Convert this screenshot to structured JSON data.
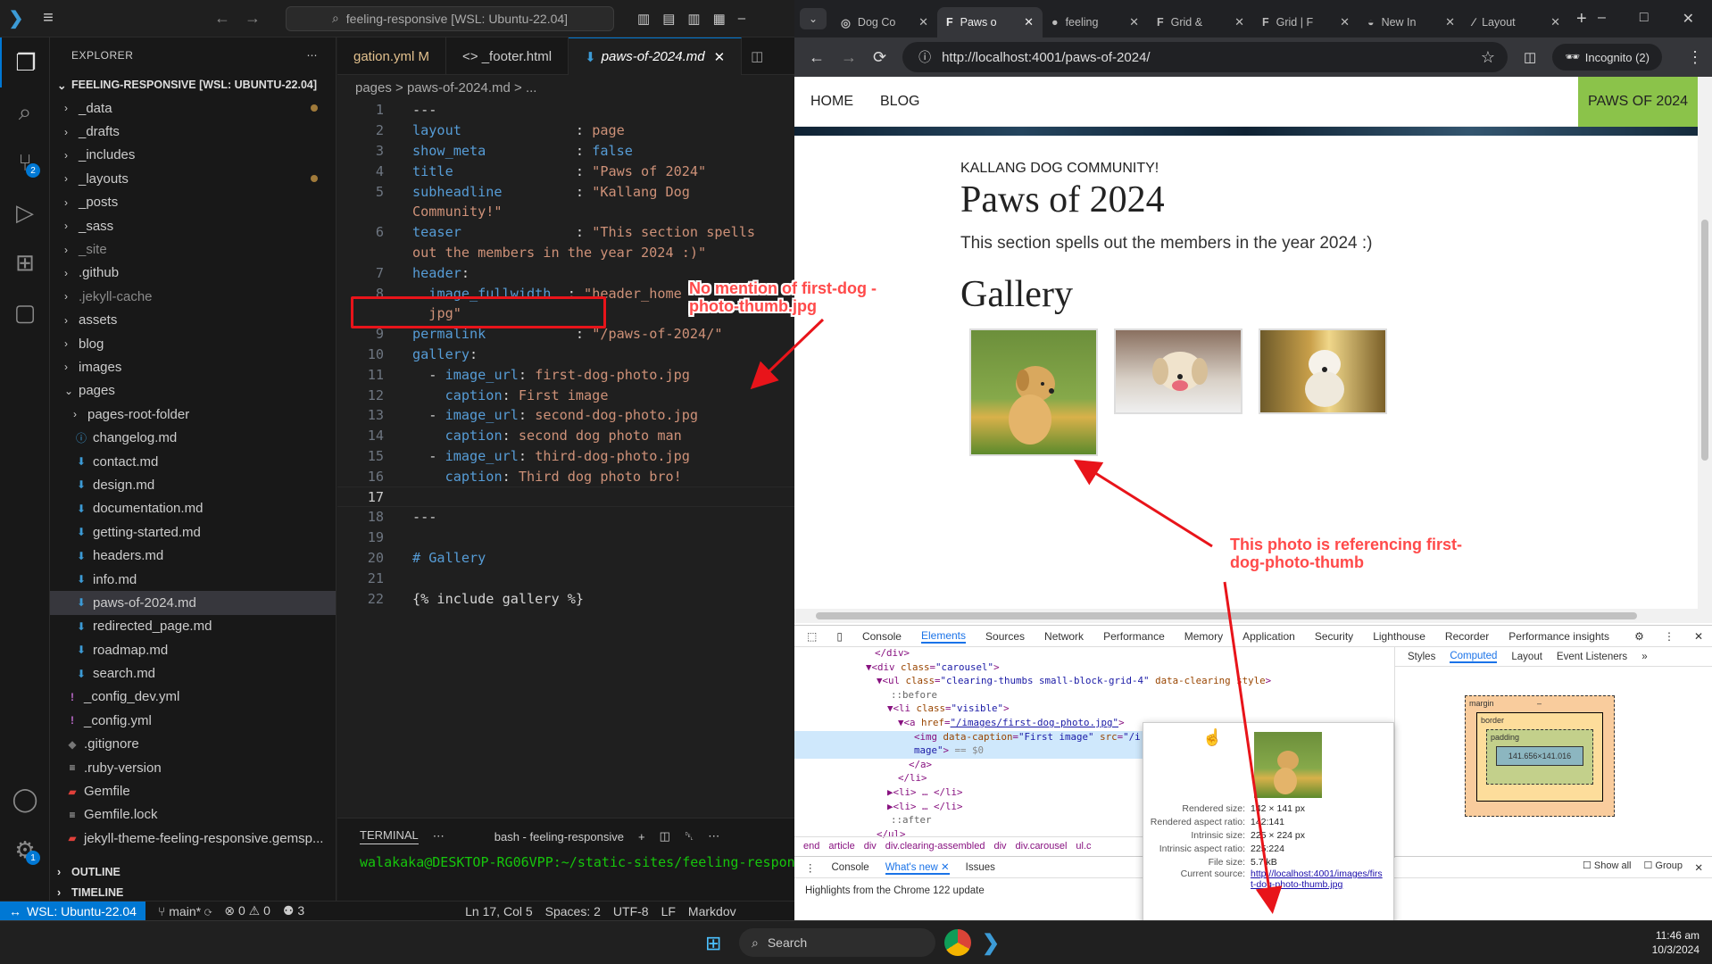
{
  "vscode": {
    "command_center": "feeling-responsive [WSL: Ubuntu-22.04]",
    "explorer_title": "EXPLORER",
    "root": "FEELING-RESPONSIVE [WSL: UBUNTU-22.04]",
    "source_control_badge": "2",
    "settings_badge": "1",
    "tree": [
      {
        "label": "_data",
        "type": "folder",
        "modified": true
      },
      {
        "label": "_drafts",
        "type": "folder"
      },
      {
        "label": "_includes",
        "type": "folder"
      },
      {
        "label": "_layouts",
        "type": "folder",
        "modified": true
      },
      {
        "label": "_posts",
        "type": "folder"
      },
      {
        "label": "_sass",
        "type": "folder"
      },
      {
        "label": "_site",
        "type": "folder",
        "dim": true
      },
      {
        "label": ".github",
        "type": "folder"
      },
      {
        "label": ".jekyll-cache",
        "type": "folder",
        "dim": true
      },
      {
        "label": "assets",
        "type": "folder"
      },
      {
        "label": "blog",
        "type": "folder"
      },
      {
        "label": "images",
        "type": "folder"
      },
      {
        "label": "pages",
        "type": "folder-open"
      },
      {
        "label": "pages-root-folder",
        "type": "subfolder"
      },
      {
        "label": "changelog.md",
        "type": "file",
        "icon": "info"
      },
      {
        "label": "contact.md",
        "type": "file"
      },
      {
        "label": "design.md",
        "type": "file"
      },
      {
        "label": "documentation.md",
        "type": "file"
      },
      {
        "label": "getting-started.md",
        "type": "file"
      },
      {
        "label": "headers.md",
        "type": "file"
      },
      {
        "label": "info.md",
        "type": "file"
      },
      {
        "label": "paws-of-2024.md",
        "type": "file",
        "selected": true
      },
      {
        "label": "redirected_page.md",
        "type": "file"
      },
      {
        "label": "roadmap.md",
        "type": "file"
      },
      {
        "label": "search.md",
        "type": "file"
      },
      {
        "label": "_config_dev.yml",
        "type": "yml"
      },
      {
        "label": "_config.yml",
        "type": "yml"
      },
      {
        "label": ".gitignore",
        "type": "git"
      },
      {
        "label": ".ruby-version",
        "type": "plain"
      },
      {
        "label": "Gemfile",
        "type": "ruby"
      },
      {
        "label": "Gemfile.lock",
        "type": "plain"
      },
      {
        "label": "jekyll-theme-feeling-responsive.gemsp...",
        "type": "ruby"
      }
    ],
    "outline": "OUTLINE",
    "timeline": "TIMELINE",
    "tabs": [
      {
        "label": "gation.yml M",
        "active": false
      },
      {
        "label": "<> _footer.html",
        "active": false
      },
      {
        "label": "paws-of-2024.md",
        "active": true
      }
    ],
    "breadcrumb": "pages > paws-of-2024.md > ...",
    "code_lines": [
      {
        "n": "1",
        "html": "<span class='p'>---</span>"
      },
      {
        "n": "2",
        "html": "<span class='k'>layout</span>              <span class='p'>: </span><span class='s'>page</span>"
      },
      {
        "n": "3",
        "html": "<span class='k'>show_meta</span>           <span class='p'>: </span><span class='k'>false</span>"
      },
      {
        "n": "4",
        "html": "<span class='k'>title</span>               <span class='p'>: </span><span class='s'>\"Paws of 2024\"</span>"
      },
      {
        "n": "5",
        "html": "<span class='k'>subheadline</span>         <span class='p'>: </span><span class='s'>\"Kallang Dog</span>"
      },
      {
        "n": "",
        "html": "<span class='s'>Community!\"</span>"
      },
      {
        "n": "6",
        "html": "<span class='k'>teaser</span>              <span class='p'>: </span><span class='s'>\"This section spells</span>"
      },
      {
        "n": "",
        "html": "<span class='s'>out the members in the year 2024 :)\"</span>"
      },
      {
        "n": "7",
        "html": "<span class='k'>header</span><span class='p'>:</span>"
      },
      {
        "n": "8",
        "html": "  <span class='k'>image_fullwidth</span>  <span class='p'>: </span><span class='s'>\"header_home</span>"
      },
      {
        "n": "",
        "html": "  <span class='s'>jpg\"</span>"
      },
      {
        "n": "9",
        "html": "<span class='k'>permalink</span>           <span class='p'>: </span><span class='s'>\"/paws-of-2024/\"</span>"
      },
      {
        "n": "10",
        "html": "<span class='k'>gallery</span><span class='p'>:</span>"
      },
      {
        "n": "11",
        "html": "  <span class='p'>- </span><span class='k'>image_url</span><span class='p'>: </span><span class='s'>first-dog-photo.jpg</span>"
      },
      {
        "n": "12",
        "html": "    <span class='k'>caption</span><span class='p'>: </span><span class='s'>First image</span>"
      },
      {
        "n": "13",
        "html": "  <span class='p'>- </span><span class='k'>image_url</span><span class='p'>: </span><span class='s'>second-dog-photo.jpg</span>"
      },
      {
        "n": "14",
        "html": "    <span class='k'>caption</span><span class='p'>: </span><span class='s'>second dog photo man</span>"
      },
      {
        "n": "15",
        "html": "  <span class='p'>- </span><span class='k'>image_url</span><span class='p'>: </span><span class='s'>third-dog-photo.jpg</span>"
      },
      {
        "n": "16",
        "html": "    <span class='k'>caption</span><span class='p'>: </span><span class='s'>Third dog photo bro!</span>"
      },
      {
        "n": "17",
        "html": "",
        "cur": true
      },
      {
        "n": "18",
        "html": "<span class='p'>---</span>"
      },
      {
        "n": "19",
        "html": ""
      },
      {
        "n": "20",
        "html": "<span class='k'># Gallery</span>"
      },
      {
        "n": "21",
        "html": ""
      },
      {
        "n": "22",
        "html": "<span class='p'>{% include gallery %}</span>"
      }
    ],
    "terminal_tab": "TERMINAL",
    "terminal_shell": "bash - feeling-responsive",
    "terminal_prompt": "walakaka@DESKTOP-RG06VPP:~/static-sites/feeling-respon",
    "status": {
      "remote": "WSL: Ubuntu-22.04",
      "branch": "main*",
      "problems": "⊗ 0 ⚠ 0",
      "ports": "3",
      "position": "Ln 17, Col 5",
      "spaces": "Spaces: 2",
      "encoding": "UTF-8",
      "eol": "LF",
      "language": "Markdov"
    }
  },
  "chrome": {
    "tabs": [
      {
        "label": "Dog Co",
        "active": false
      },
      {
        "label": "Paws o",
        "active": true
      },
      {
        "label": "feeling",
        "active": false
      },
      {
        "label": "Grid &",
        "active": false
      },
      {
        "label": "Grid | F",
        "active": false
      },
      {
        "label": "New In",
        "active": false
      },
      {
        "label": "Layout",
        "active": false
      }
    ],
    "url": "http://localhost:4001/paws-of-2024/",
    "incognito": "Incognito (2)",
    "page": {
      "nav_home": "HOME",
      "nav_blog": "BLOG",
      "nav_title": "PAWS OF 2024",
      "subheadline": "KALLANG DOG COMMUNITY!",
      "title": "Paws of 2024",
      "teaser": "This section spells out the members in the year 2024 :)",
      "gallery_heading": "Gallery"
    },
    "devtools": {
      "tabs": [
        "Console",
        "Elements",
        "Sources",
        "Network",
        "Performance",
        "Memory",
        "Application",
        "Security",
        "Lighthouse",
        "Recorder",
        "Performance insights"
      ],
      "active_tab": "Elements",
      "styles_tabs": [
        "Styles",
        "Computed",
        "Layout",
        "Event Listeners"
      ],
      "active_styles_tab": "Computed",
      "box": {
        "margin": "margin",
        "border": "border",
        "padding": "padding",
        "content": "141.656×141.016",
        "dash": "–"
      },
      "crumbs": [
        "end",
        "article",
        "div",
        "div.clearing-assembled",
        "div",
        "div.carousel",
        "ul.c"
      ],
      "drawer_tabs": [
        "Console",
        "What's new",
        "Issues"
      ],
      "drawer_text": "Highlights from the Chrome 122 update",
      "show_all": "Show all",
      "group": "Group",
      "hover": {
        "rendered_size": "142 × 141 px",
        "rendered_aspect": "142:141",
        "intrinsic_size": "225 × 224 px",
        "intrinsic_aspect": "225:224",
        "file_size": "5.7 kB",
        "current_source": "http://localhost:4001/images/first-dog-photo-thumb.jpg"
      }
    }
  },
  "taskbar": {
    "search": "Search",
    "time": "11:46 am",
    "date": "10/3/2024"
  },
  "annotations": {
    "note1": "No mention of first-dog -photo-thumb.jpg",
    "note2": "This photo is referencing first- dog-photo-thumb"
  }
}
